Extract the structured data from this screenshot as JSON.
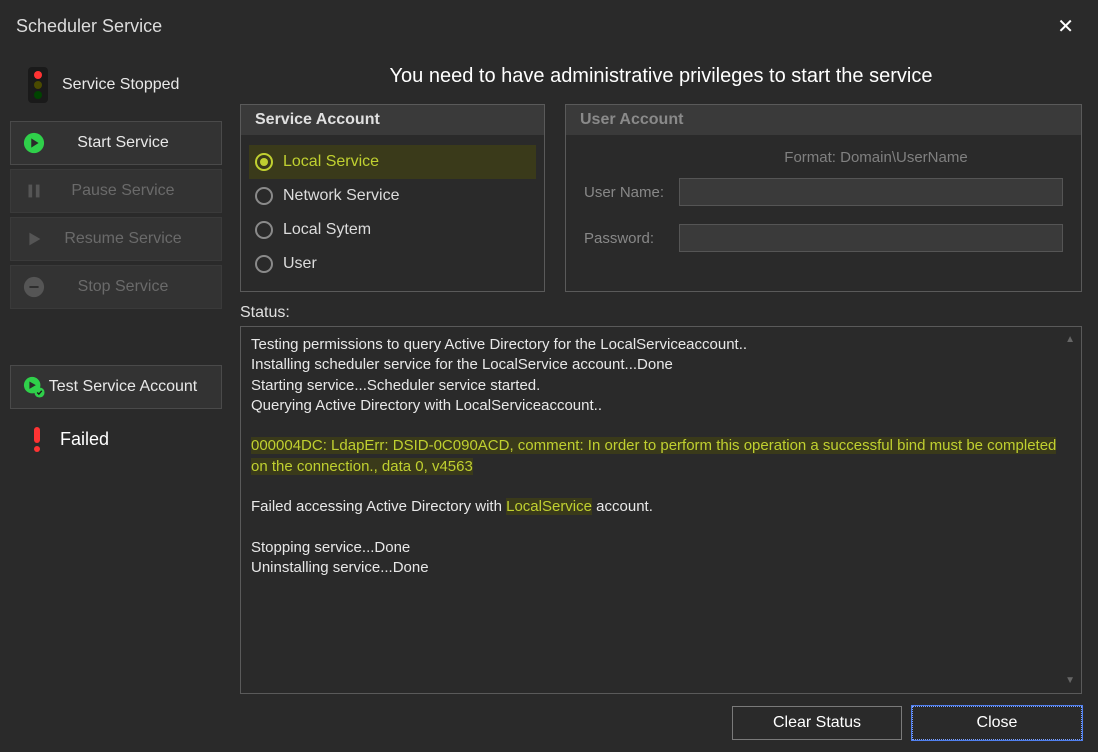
{
  "window": {
    "title": "Scheduler Service"
  },
  "service_state": {
    "label": "Service  Stopped"
  },
  "actions": {
    "start": "Start Service",
    "pause": "Pause Service",
    "resume": "Resume Service",
    "stop": "Stop Service",
    "test": "Test Service Account"
  },
  "test_result": {
    "label": "Failed"
  },
  "main": {
    "admin_message": "You need to have administrative privileges to start the service"
  },
  "service_account_panel": {
    "title": "Service Account",
    "options": {
      "local_service": "Local Service",
      "network_service": "Network Service",
      "local_system": "Local Sytem",
      "user": "User"
    },
    "selected": "local_service"
  },
  "user_account_panel": {
    "title": "User Account",
    "format_hint": "Format: Domain\\UserName",
    "username_label": "User Name:",
    "password_label": "Password:",
    "username_value": "",
    "password_value": ""
  },
  "status": {
    "label": "Status:",
    "lines": {
      "l1": "Testing permissions to query Active Directory for the LocalServiceaccount..",
      "l2": "Installing scheduler service for the LocalService account...Done",
      "l3": "Starting service...Scheduler service started.",
      "l4": "Querying Active Directory with LocalServiceaccount..",
      "l5": "000004DC: LdapErr: DSID-0C090ACD, comment: In order to perform this operation a successful bind must be completed on the connection., data 0, v4563",
      "l6a": "Failed accessing Active Directory with ",
      "l6b": "LocalService",
      "l6c": " account.",
      "l7": "Stopping service...Done",
      "l8": "Uninstalling service...Done"
    }
  },
  "footer": {
    "clear": "Clear Status",
    "close": "Close"
  },
  "colors": {
    "accent": "#c0d030",
    "enabled_green": "#2fd04a",
    "fail_red": "#ff3333"
  }
}
